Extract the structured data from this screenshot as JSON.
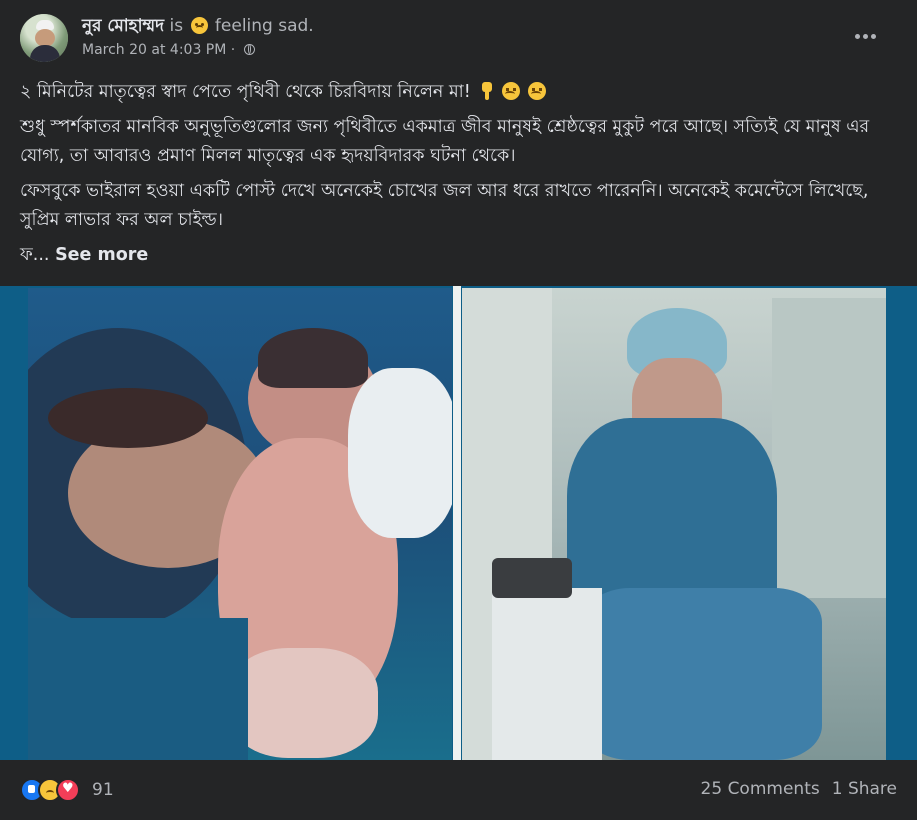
{
  "post": {
    "author": "নুর মোহাম্মদ",
    "is_text": "is",
    "feeling": "feeling sad.",
    "timestamp": "March 20 at 4:03 PM",
    "separator": "·",
    "paragraphs": [
      "২ মিনিটের মাতৃত্বের স্বাদ পেতে পৃথিবী থেকে চিরবিদায় নিলেন মা!",
      "শুধু স্পর্শকাতর মানবিক অনুভূতিগুলোর জন্য পৃথিবীতে একমাত্র জীব মানুষই শ্রেষ্ঠত্বের মুকুট পরে আছে। সত্যিই যে মানুষ এর যোগ্য, তা আবারও প্রমাণ মিলল মাতৃত্বের এক হৃদয়বিদারক ঘটনা থেকে।",
      "ফেসবুকে ভাইরাল হওয়া একটি পোস্ট দেখে অনেকেই চোখের জল আর ধরে রাখতে পারেননি। অনেকেই কমেন্টেসে লিখেছে, সুপ্রিম লাভার ফর অল চাইল্ড।"
    ],
    "truncated_text": "ফ...",
    "see_more": "See more"
  },
  "footer": {
    "reaction_count": "91",
    "comments": "25 Comments",
    "shares": "1 Share"
  },
  "icons": [
    "privacy-globe-icon",
    "more-options-icon",
    "sad-emoji-icon",
    "pointing-down-emoji-icon",
    "like-reaction-icon",
    "sad-reaction-icon",
    "love-reaction-icon"
  ]
}
